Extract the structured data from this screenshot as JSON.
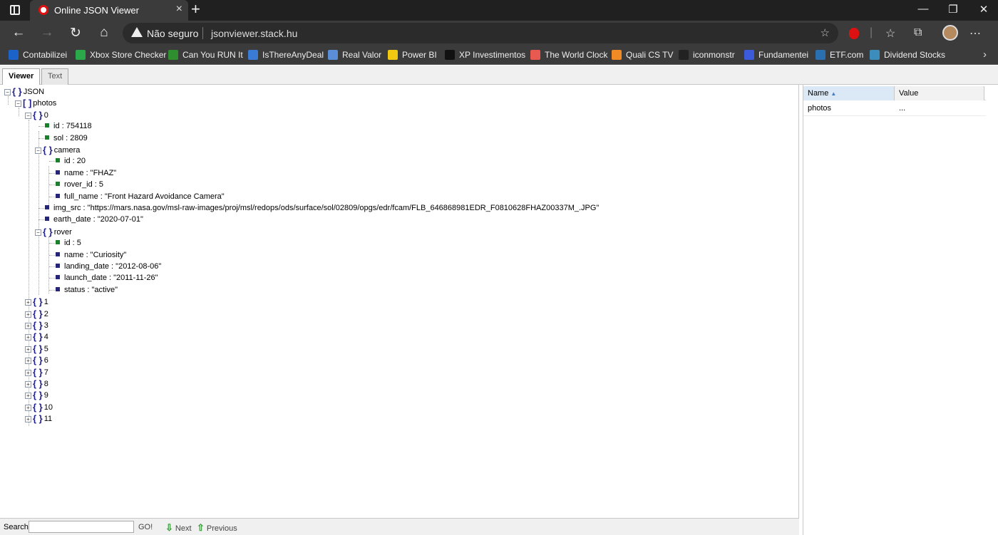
{
  "browser": {
    "tab_title": "Online JSON Viewer",
    "security_label": "Não seguro",
    "url": "jsonviewer.stack.hu",
    "bookmarks": [
      {
        "label": "Contabilizei",
        "color": "#1b63c9"
      },
      {
        "label": "Xbox Store Checker",
        "color": "#2ba84a"
      },
      {
        "label": "Can You RUN It",
        "color": "#2f8f2f"
      },
      {
        "label": "IsThereAnyDeal",
        "color": "#3a7bd5"
      },
      {
        "label": "Real Valor",
        "color": "#5a8fd8"
      },
      {
        "label": "Power BI",
        "color": "#f2c811"
      },
      {
        "label": "XP Investimentos",
        "color": "#111111"
      },
      {
        "label": "The World Clock",
        "color": "#e85a4f"
      },
      {
        "label": "Quali CS TV",
        "color": "#f08a24"
      },
      {
        "label": "iconmonstr",
        "color": "#222222"
      },
      {
        "label": "Fundamentei",
        "color": "#3b5bdb"
      },
      {
        "label": "ETF.com",
        "color": "#2a6fb0"
      },
      {
        "label": "Dividend Stocks",
        "color": "#3c8dbc"
      }
    ]
  },
  "viewer": {
    "tabs": [
      "Viewer",
      "Text"
    ],
    "tree": [
      {
        "text": "JSON",
        "icon": "obj",
        "toggle": "−"
      },
      {
        "text": "photos",
        "icon": "arr",
        "toggle": "−"
      },
      {
        "text": "0",
        "icon": "obj",
        "toggle": "−"
      },
      {
        "text": "id : 754118",
        "icon": "num"
      },
      {
        "text": "sol : 2809",
        "icon": "num"
      },
      {
        "text": "camera",
        "icon": "obj",
        "toggle": "−"
      },
      {
        "text": "id : 20",
        "icon": "num"
      },
      {
        "text": "name : \"FHAZ\"",
        "icon": "str"
      },
      {
        "text": "rover_id : 5",
        "icon": "num"
      },
      {
        "text": "full_name : \"Front Hazard Avoidance Camera\"",
        "icon": "str"
      },
      {
        "text": "img_src : \"https://mars.nasa.gov/msl-raw-images/proj/msl/redops/ods/surface/sol/02809/opgs/edr/fcam/FLB_646868981EDR_F0810628FHAZ00337M_.JPG\"",
        "icon": "str"
      },
      {
        "text": "earth_date : \"2020-07-01\"",
        "icon": "str"
      },
      {
        "text": "rover",
        "icon": "obj",
        "toggle": "−"
      },
      {
        "text": "id : 5",
        "icon": "num"
      },
      {
        "text": "name : \"Curiosity\"",
        "icon": "str"
      },
      {
        "text": "landing_date : \"2012-08-06\"",
        "icon": "str"
      },
      {
        "text": "launch_date : \"2011-11-26\"",
        "icon": "str"
      },
      {
        "text": "status : \"active\"",
        "icon": "str"
      },
      {
        "text": "1",
        "icon": "obj",
        "toggle": "+"
      },
      {
        "text": "2",
        "icon": "obj",
        "toggle": "+"
      },
      {
        "text": "3",
        "icon": "obj",
        "toggle": "+"
      },
      {
        "text": "4",
        "icon": "obj",
        "toggle": "+"
      },
      {
        "text": "5",
        "icon": "obj",
        "toggle": "+"
      },
      {
        "text": "6",
        "icon": "obj",
        "toggle": "+"
      },
      {
        "text": "7",
        "icon": "obj",
        "toggle": "+"
      },
      {
        "text": "8",
        "icon": "obj",
        "toggle": "+"
      },
      {
        "text": "9",
        "icon": "obj",
        "toggle": "+"
      },
      {
        "text": "10",
        "icon": "obj",
        "toggle": "+"
      },
      {
        "text": "11",
        "icon": "obj",
        "toggle": "+"
      }
    ],
    "props": {
      "col_name": "Name",
      "col_value": "Value",
      "row_name": "photos",
      "row_value": "..."
    },
    "search": {
      "label": "Search:",
      "value": "",
      "go": "GO!",
      "next": "Next",
      "previous": "Previous"
    }
  }
}
